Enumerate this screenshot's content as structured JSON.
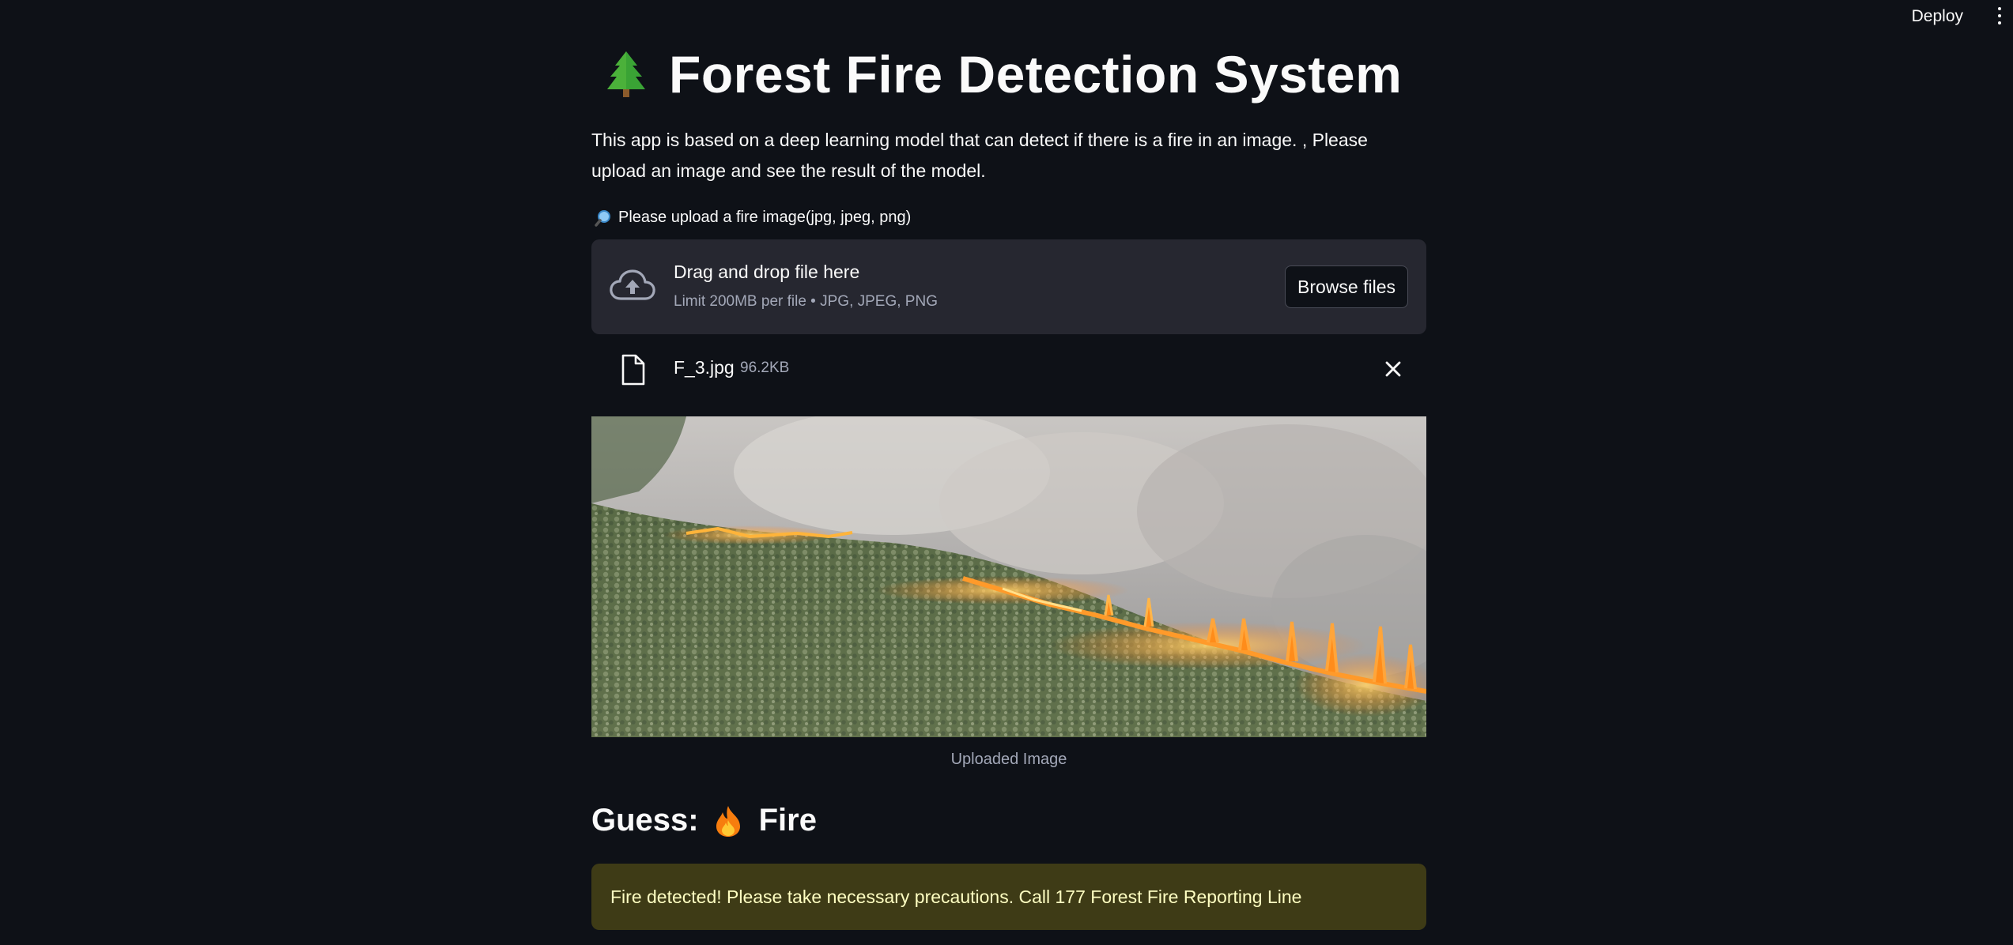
{
  "header": {
    "deploy_label": "Deploy"
  },
  "page": {
    "title": "Forest Fire Detection System",
    "description": "This app is based on a deep learning model that can detect if there is a fire in an image. , Please upload an image and see the result of the model."
  },
  "uploader": {
    "label": "Please upload a fire image(jpg, jpeg, png)",
    "dropzone_title": "Drag and drop file here",
    "dropzone_limit": "Limit 200MB per file • JPG, JPEG, PNG",
    "browse_label": "Browse files"
  },
  "uploaded_file": {
    "name": "F_3.jpg",
    "size": "96.2KB"
  },
  "image": {
    "caption": "Uploaded Image"
  },
  "result": {
    "guess_prefix": "Guess:",
    "guess_value": "Fire",
    "alert_text": "Fire detected! Please take necessary precautions. Call 177 Forest Fire Reporting Line"
  },
  "icons": {
    "title": "evergreen-tree-icon",
    "upload_label": "magnifier-icon",
    "dropzone": "cloud-upload-icon",
    "file": "file-icon",
    "remove_file": "close-icon",
    "guess": "fire-icon",
    "menu": "kebab-menu-icon"
  },
  "colors": {
    "background": "#0e1117",
    "dropzone_bg": "#262730",
    "alert_bg": "#3e3b16",
    "alert_text": "#ffffc2",
    "muted_text": "#a3a8b8"
  }
}
